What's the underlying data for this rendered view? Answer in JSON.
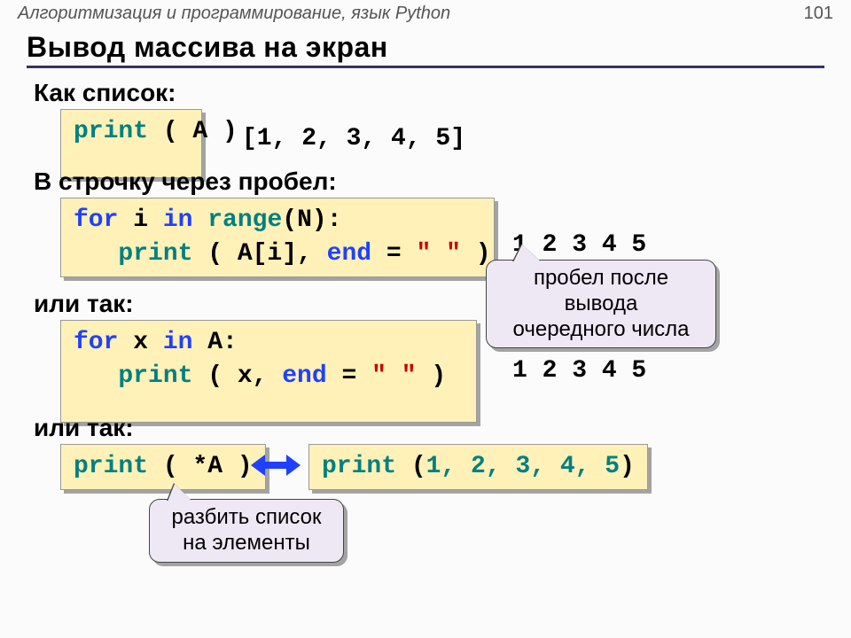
{
  "header": {
    "course": "Алгоритмизация и программирование, язык Python",
    "page": "101"
  },
  "title": "Вывод массива на экран",
  "labels": {
    "as_list": "Как список:",
    "as_line": "В строчку через пробел:",
    "or1": "или так:",
    "or2": "или так:"
  },
  "code": {
    "box1_print": "print",
    "box1_arg": " ( A )",
    "out1": "[1, 2, 3, 4, 5]",
    "box2_for": "for",
    "box2_i": " i ",
    "box2_in": "in",
    "box2_range": " range",
    "box2_rangearg": "(N):",
    "box2_print": "   print",
    "box2_printarg_a": " ( A[i], ",
    "box2_end": "end",
    "box2_eq": " = ",
    "box2_space": "\" \"",
    "box2_close": " )",
    "out2": "1 2 3 4 5",
    "box3_for": "for",
    "box3_x": " x ",
    "box3_in": "in",
    "box3_A": " A:",
    "box3_print": "   print",
    "box3_printarg": " ( x, ",
    "box3_end": "end",
    "box3_eq": " = ",
    "box3_space": "\" \"",
    "box3_close": " )",
    "out3": "1 2 3 4 5",
    "box4_print": "print",
    "box4_arg": " ( *A )",
    "box5_print": "print",
    "box5_open": " (",
    "box5_nums": "1, 2, 3, 4, 5",
    "box5_close": ")"
  },
  "callouts": {
    "space_after": "пробел после\nвывода\nочередного числа",
    "split_list": "разбить список\nна элементы"
  }
}
